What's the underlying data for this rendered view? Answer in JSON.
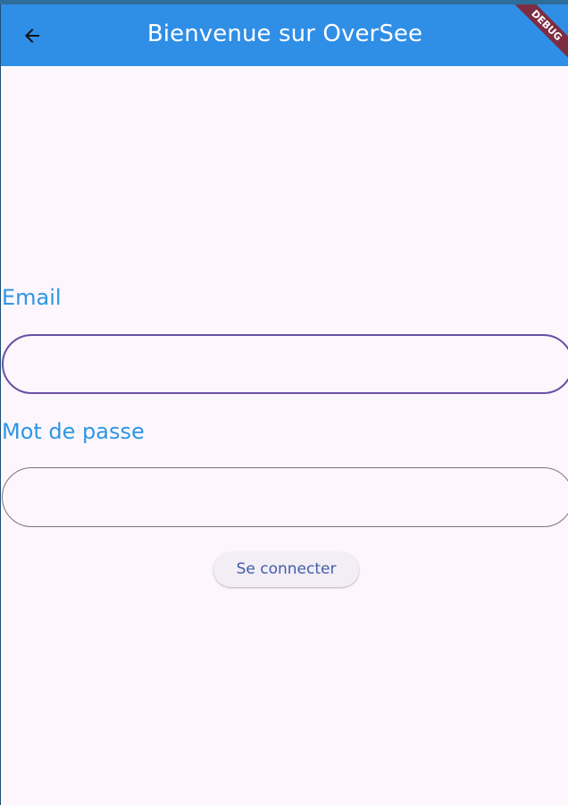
{
  "app_bar": {
    "title": "Bienvenue sur OverSee",
    "back_icon": "arrow-left-icon",
    "background_color": "#2f8ee6"
  },
  "debug_banner": {
    "label": "DEBUG",
    "color": "#7d2d42"
  },
  "form": {
    "email_label": "Email",
    "email_value": "",
    "password_label": "Mot de passe",
    "password_value": "",
    "label_color": "#2d96e4",
    "focused_border_color": "#6a4fa3"
  },
  "actions": {
    "login_label": "Se connecter"
  }
}
